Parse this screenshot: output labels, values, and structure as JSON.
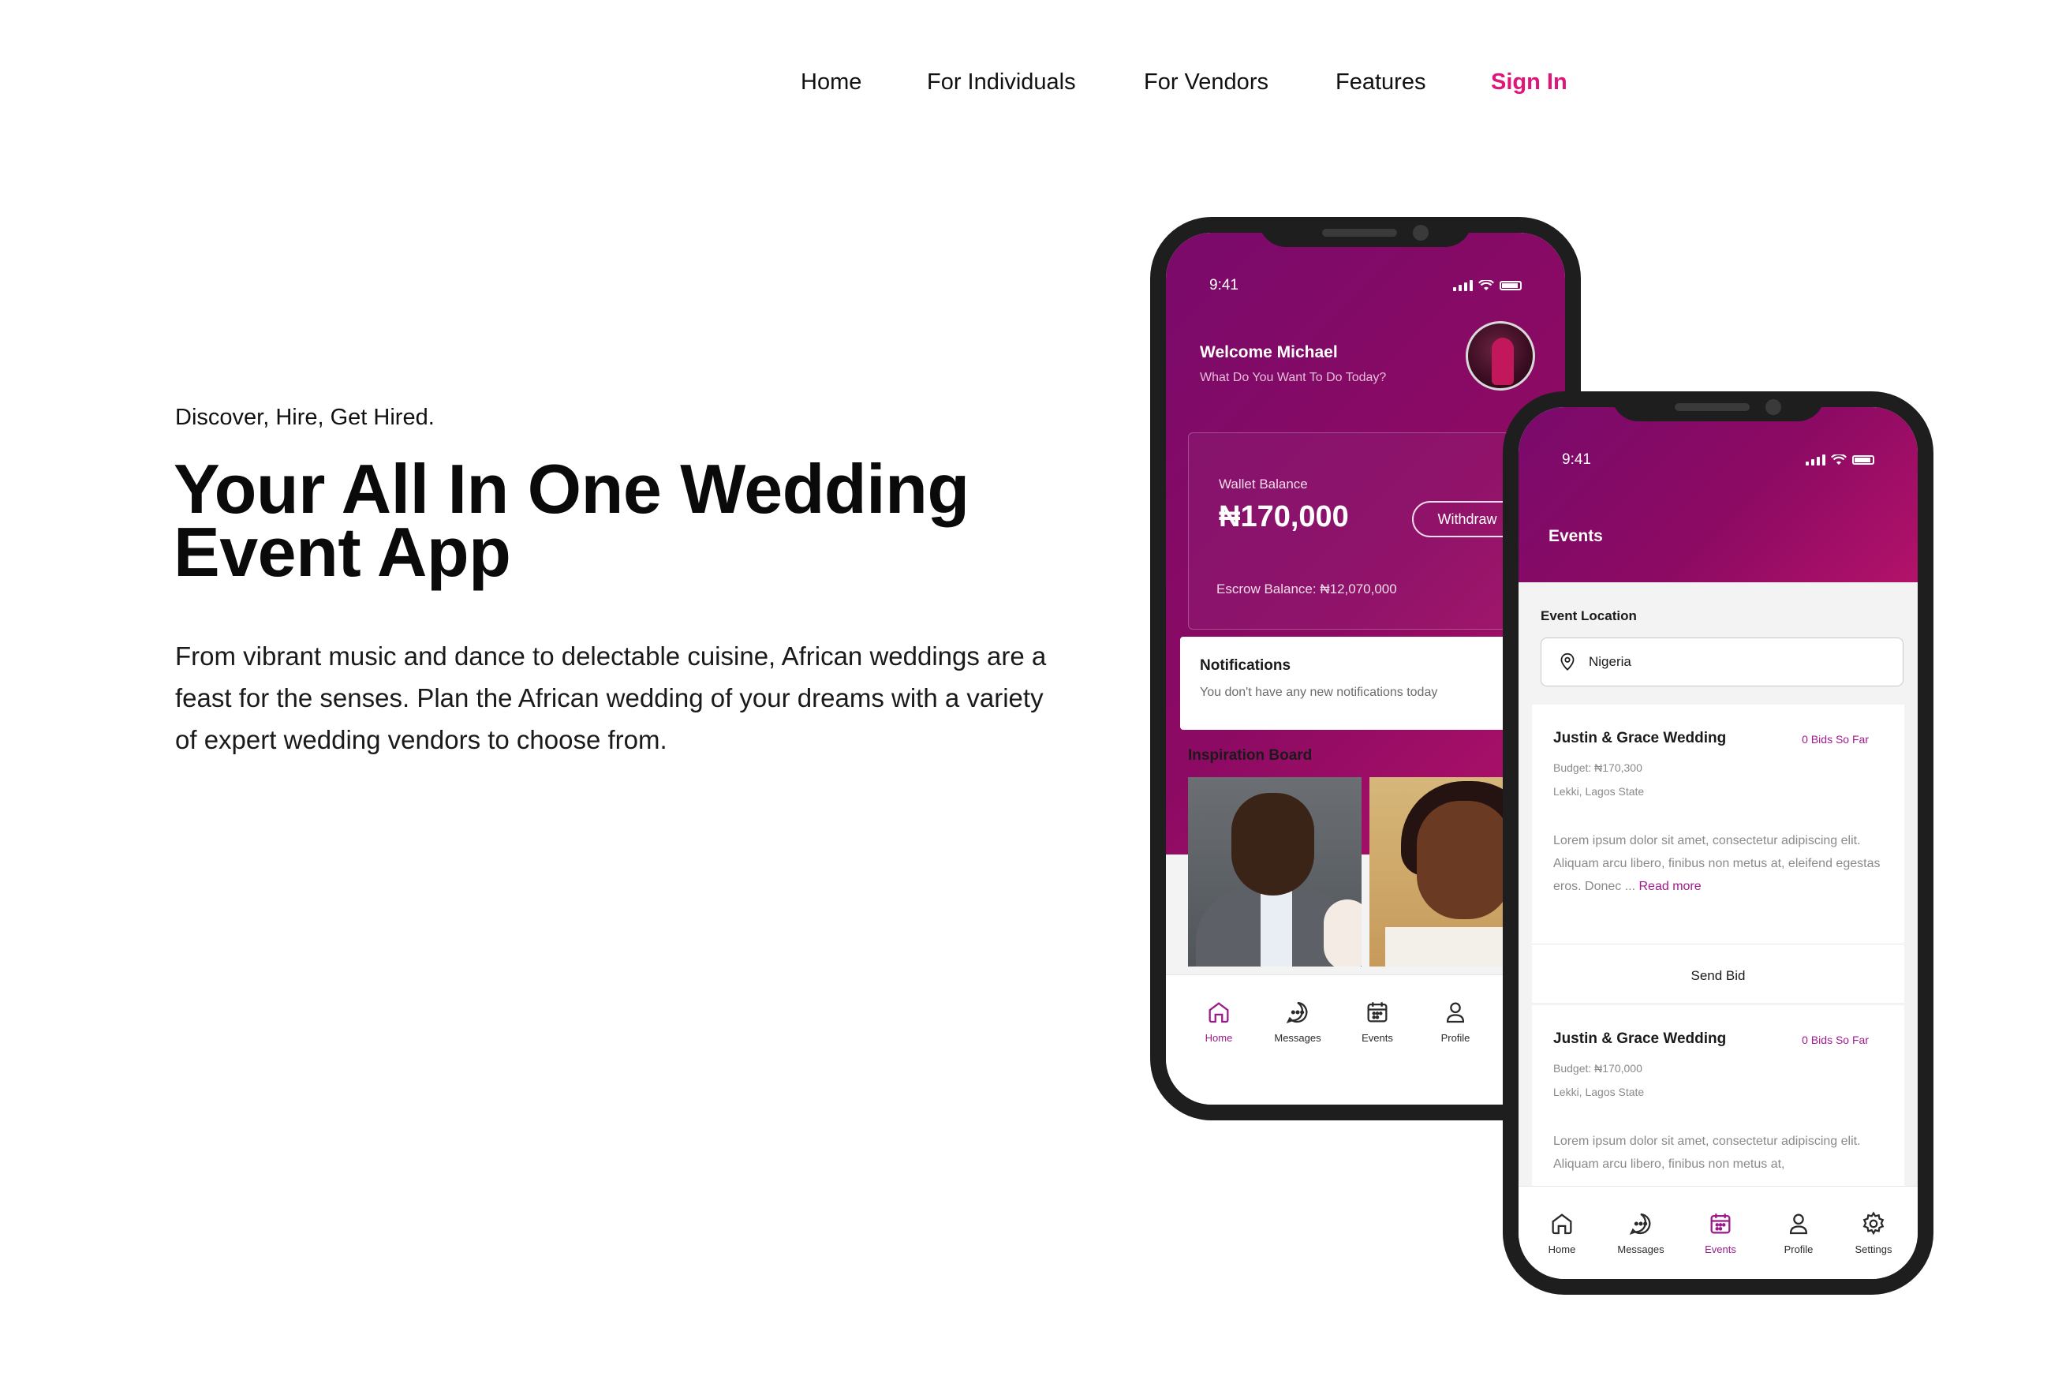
{
  "nav": {
    "home": "Home",
    "individuals": "For Individuals",
    "vendors": "For Vendors",
    "features": "Features",
    "sign_in": "Sign In"
  },
  "hero": {
    "tagline": "Discover, Hire, Get Hired.",
    "headline_line1": "Your All In One Wedding",
    "headline_line2": "Event App",
    "intro": "From vibrant music and dance to delectable cuisine, African weddings are a feast for the senses. Plan the African wedding of your dreams with a variety of expert wedding vendors to choose from."
  },
  "phone1": {
    "time": "9:41",
    "welcome": "Welcome Michael",
    "subtitle": "What Do You Want To Do Today?",
    "wallet_label": "Wallet Balance",
    "wallet_amount": "₦170,000",
    "withdraw": "Withdraw",
    "escrow": "Escrow Balance: ₦12,070,000",
    "notifications_title": "Notifications",
    "notifications_text": "You don't have any new notifications today",
    "inspiration_title": "Inspiration Board",
    "tabs": [
      "Home",
      "Messages",
      "Events",
      "Profile"
    ],
    "active_tab": "Home"
  },
  "phone2": {
    "time": "9:41",
    "title": "Events",
    "location_label": "Event Location",
    "location_value": "Nigeria",
    "cards": [
      {
        "title": "Justin & Grace Wedding",
        "bids": "0 Bids So Far",
        "budget": "Budget: ₦170,300",
        "location": "Lekki, Lagos State",
        "desc": "Lorem ipsum dolor sit amet, consectetur adipiscing elit. Aliquam arcu libero, finibus non metus at, eleifend egestas eros. Donec ...",
        "read_more": "Read more",
        "action": "Send Bid"
      },
      {
        "title": "Justin & Grace Wedding",
        "bids": "0 Bids So Far",
        "budget": "Budget: ₦170,000",
        "location": "Lekki, Lagos State",
        "desc": "Lorem ipsum dolor sit amet, consectetur adipiscing elit. Aliquam arcu libero, finibus non metus at,"
      }
    ],
    "tabs": [
      "Home",
      "Messages",
      "Events",
      "Profile",
      "Settings"
    ],
    "active_tab": "Events"
  },
  "colors": {
    "accent": "#e0157a",
    "brand_purple": "#7a0a6b",
    "brand_magenta": "#b3126a",
    "link_purple": "#a21a8f"
  }
}
